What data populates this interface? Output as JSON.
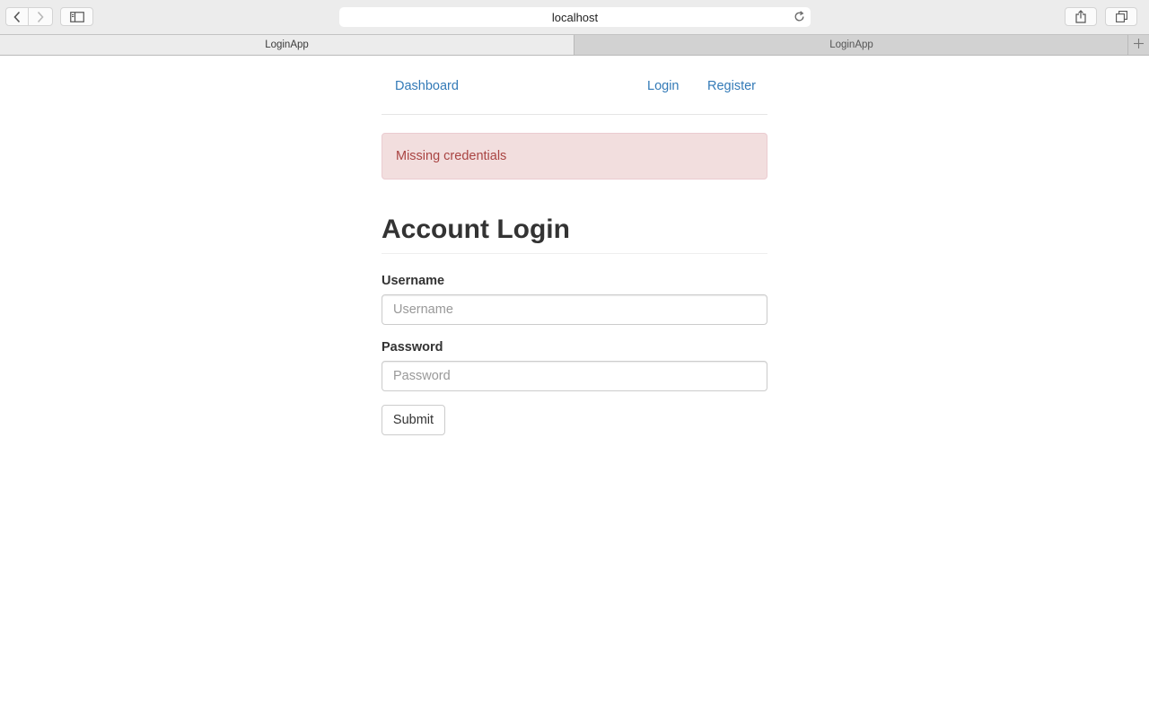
{
  "browser": {
    "url": "localhost",
    "tabs": [
      {
        "title": "LoginApp",
        "active": true
      },
      {
        "title": "LoginApp",
        "active": false
      }
    ],
    "icons": [
      "back-icon",
      "forward-icon",
      "sidebar-icon",
      "reload-icon",
      "share-icon",
      "tabs-overview-icon",
      "new-tab-icon"
    ]
  },
  "nav": {
    "dashboard": "Dashboard",
    "login": "Login",
    "register": "Register"
  },
  "alert": {
    "message": "Missing credentials",
    "text_color": "#a94442",
    "background_color": "#f2dede"
  },
  "form": {
    "title": "Account Login",
    "username": {
      "label": "Username",
      "placeholder": "Username",
      "value": ""
    },
    "password": {
      "label": "Password",
      "placeholder": "Password",
      "value": ""
    },
    "submit_label": "Submit"
  },
  "colors": {
    "link": "#337ab7"
  }
}
